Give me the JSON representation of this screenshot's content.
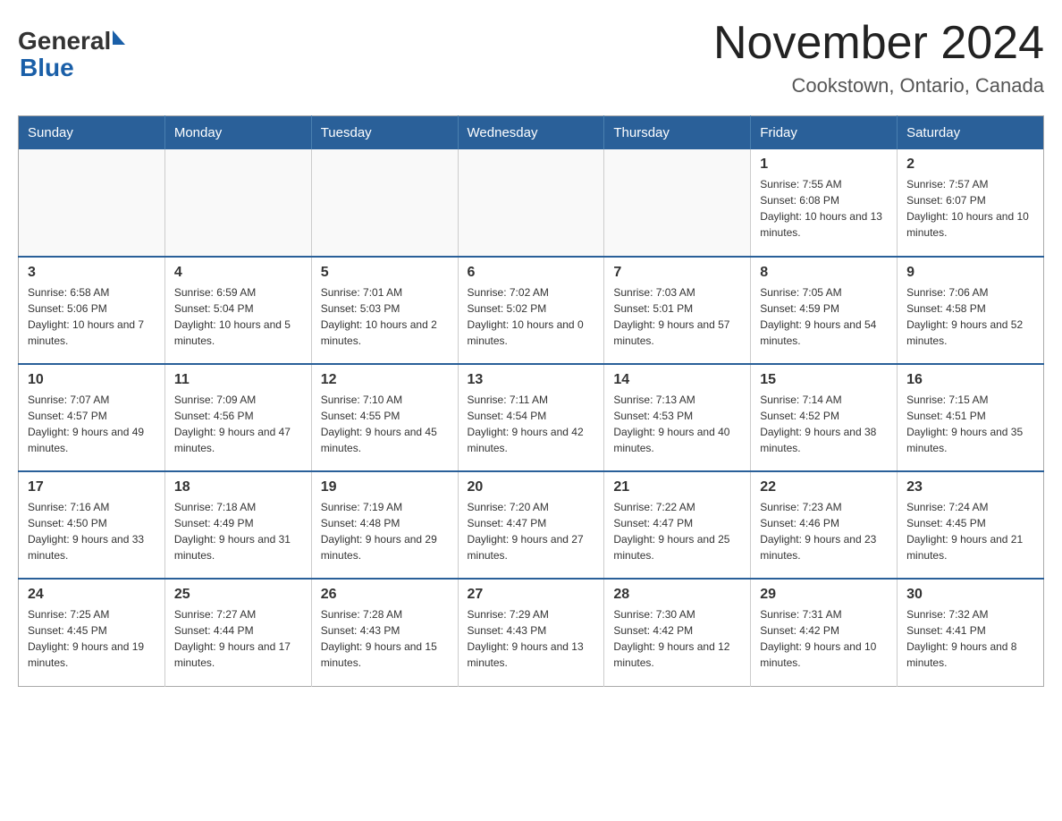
{
  "header": {
    "month_title": "November 2024",
    "location": "Cookstown, Ontario, Canada",
    "logo_general": "General",
    "logo_blue": "Blue"
  },
  "days_of_week": [
    "Sunday",
    "Monday",
    "Tuesday",
    "Wednesday",
    "Thursday",
    "Friday",
    "Saturday"
  ],
  "weeks": [
    {
      "days": [
        {
          "number": "",
          "sunrise": "",
          "sunset": "",
          "daylight": ""
        },
        {
          "number": "",
          "sunrise": "",
          "sunset": "",
          "daylight": ""
        },
        {
          "number": "",
          "sunrise": "",
          "sunset": "",
          "daylight": ""
        },
        {
          "number": "",
          "sunrise": "",
          "sunset": "",
          "daylight": ""
        },
        {
          "number": "",
          "sunrise": "",
          "sunset": "",
          "daylight": ""
        },
        {
          "number": "1",
          "sunrise": "Sunrise: 7:55 AM",
          "sunset": "Sunset: 6:08 PM",
          "daylight": "Daylight: 10 hours and 13 minutes."
        },
        {
          "number": "2",
          "sunrise": "Sunrise: 7:57 AM",
          "sunset": "Sunset: 6:07 PM",
          "daylight": "Daylight: 10 hours and 10 minutes."
        }
      ]
    },
    {
      "days": [
        {
          "number": "3",
          "sunrise": "Sunrise: 6:58 AM",
          "sunset": "Sunset: 5:06 PM",
          "daylight": "Daylight: 10 hours and 7 minutes."
        },
        {
          "number": "4",
          "sunrise": "Sunrise: 6:59 AM",
          "sunset": "Sunset: 5:04 PM",
          "daylight": "Daylight: 10 hours and 5 minutes."
        },
        {
          "number": "5",
          "sunrise": "Sunrise: 7:01 AM",
          "sunset": "Sunset: 5:03 PM",
          "daylight": "Daylight: 10 hours and 2 minutes."
        },
        {
          "number": "6",
          "sunrise": "Sunrise: 7:02 AM",
          "sunset": "Sunset: 5:02 PM",
          "daylight": "Daylight: 10 hours and 0 minutes."
        },
        {
          "number": "7",
          "sunrise": "Sunrise: 7:03 AM",
          "sunset": "Sunset: 5:01 PM",
          "daylight": "Daylight: 9 hours and 57 minutes."
        },
        {
          "number": "8",
          "sunrise": "Sunrise: 7:05 AM",
          "sunset": "Sunset: 4:59 PM",
          "daylight": "Daylight: 9 hours and 54 minutes."
        },
        {
          "number": "9",
          "sunrise": "Sunrise: 7:06 AM",
          "sunset": "Sunset: 4:58 PM",
          "daylight": "Daylight: 9 hours and 52 minutes."
        }
      ]
    },
    {
      "days": [
        {
          "number": "10",
          "sunrise": "Sunrise: 7:07 AM",
          "sunset": "Sunset: 4:57 PM",
          "daylight": "Daylight: 9 hours and 49 minutes."
        },
        {
          "number": "11",
          "sunrise": "Sunrise: 7:09 AM",
          "sunset": "Sunset: 4:56 PM",
          "daylight": "Daylight: 9 hours and 47 minutes."
        },
        {
          "number": "12",
          "sunrise": "Sunrise: 7:10 AM",
          "sunset": "Sunset: 4:55 PM",
          "daylight": "Daylight: 9 hours and 45 minutes."
        },
        {
          "number": "13",
          "sunrise": "Sunrise: 7:11 AM",
          "sunset": "Sunset: 4:54 PM",
          "daylight": "Daylight: 9 hours and 42 minutes."
        },
        {
          "number": "14",
          "sunrise": "Sunrise: 7:13 AM",
          "sunset": "Sunset: 4:53 PM",
          "daylight": "Daylight: 9 hours and 40 minutes."
        },
        {
          "number": "15",
          "sunrise": "Sunrise: 7:14 AM",
          "sunset": "Sunset: 4:52 PM",
          "daylight": "Daylight: 9 hours and 38 minutes."
        },
        {
          "number": "16",
          "sunrise": "Sunrise: 7:15 AM",
          "sunset": "Sunset: 4:51 PM",
          "daylight": "Daylight: 9 hours and 35 minutes."
        }
      ]
    },
    {
      "days": [
        {
          "number": "17",
          "sunrise": "Sunrise: 7:16 AM",
          "sunset": "Sunset: 4:50 PM",
          "daylight": "Daylight: 9 hours and 33 minutes."
        },
        {
          "number": "18",
          "sunrise": "Sunrise: 7:18 AM",
          "sunset": "Sunset: 4:49 PM",
          "daylight": "Daylight: 9 hours and 31 minutes."
        },
        {
          "number": "19",
          "sunrise": "Sunrise: 7:19 AM",
          "sunset": "Sunset: 4:48 PM",
          "daylight": "Daylight: 9 hours and 29 minutes."
        },
        {
          "number": "20",
          "sunrise": "Sunrise: 7:20 AM",
          "sunset": "Sunset: 4:47 PM",
          "daylight": "Daylight: 9 hours and 27 minutes."
        },
        {
          "number": "21",
          "sunrise": "Sunrise: 7:22 AM",
          "sunset": "Sunset: 4:47 PM",
          "daylight": "Daylight: 9 hours and 25 minutes."
        },
        {
          "number": "22",
          "sunrise": "Sunrise: 7:23 AM",
          "sunset": "Sunset: 4:46 PM",
          "daylight": "Daylight: 9 hours and 23 minutes."
        },
        {
          "number": "23",
          "sunrise": "Sunrise: 7:24 AM",
          "sunset": "Sunset: 4:45 PM",
          "daylight": "Daylight: 9 hours and 21 minutes."
        }
      ]
    },
    {
      "days": [
        {
          "number": "24",
          "sunrise": "Sunrise: 7:25 AM",
          "sunset": "Sunset: 4:45 PM",
          "daylight": "Daylight: 9 hours and 19 minutes."
        },
        {
          "number": "25",
          "sunrise": "Sunrise: 7:27 AM",
          "sunset": "Sunset: 4:44 PM",
          "daylight": "Daylight: 9 hours and 17 minutes."
        },
        {
          "number": "26",
          "sunrise": "Sunrise: 7:28 AM",
          "sunset": "Sunset: 4:43 PM",
          "daylight": "Daylight: 9 hours and 15 minutes."
        },
        {
          "number": "27",
          "sunrise": "Sunrise: 7:29 AM",
          "sunset": "Sunset: 4:43 PM",
          "daylight": "Daylight: 9 hours and 13 minutes."
        },
        {
          "number": "28",
          "sunrise": "Sunrise: 7:30 AM",
          "sunset": "Sunset: 4:42 PM",
          "daylight": "Daylight: 9 hours and 12 minutes."
        },
        {
          "number": "29",
          "sunrise": "Sunrise: 7:31 AM",
          "sunset": "Sunset: 4:42 PM",
          "daylight": "Daylight: 9 hours and 10 minutes."
        },
        {
          "number": "30",
          "sunrise": "Sunrise: 7:32 AM",
          "sunset": "Sunset: 4:41 PM",
          "daylight": "Daylight: 9 hours and 8 minutes."
        }
      ]
    }
  ]
}
